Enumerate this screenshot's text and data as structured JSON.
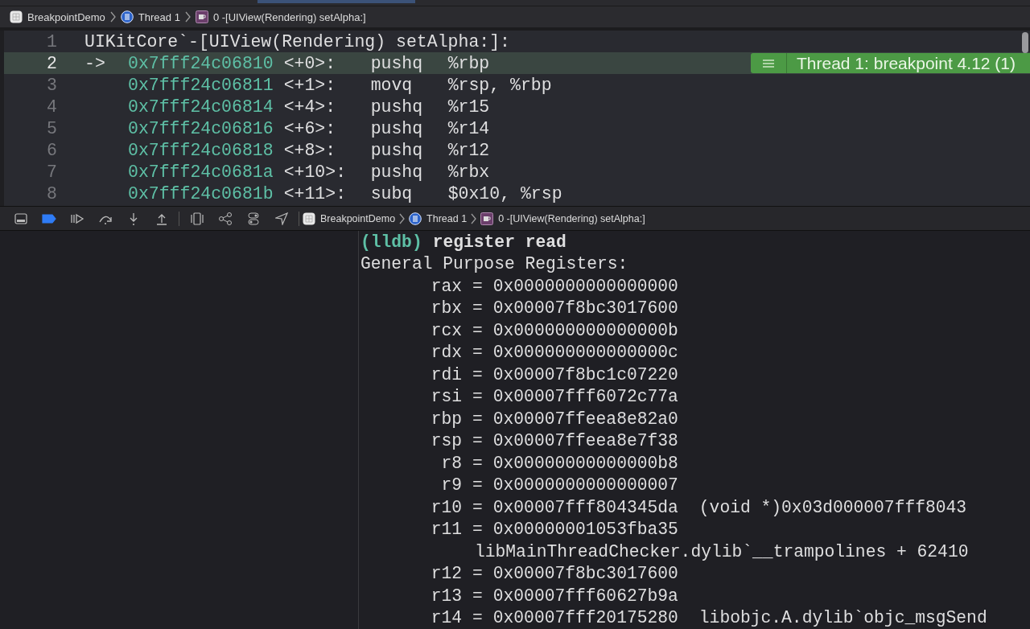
{
  "breadcrumb": [
    {
      "kind": "project",
      "label": "BreakpointDemo"
    },
    {
      "kind": "thread",
      "label": "Thread 1"
    },
    {
      "kind": "frame",
      "label": "0 -[UIView(Rendering) setAlpha:]"
    }
  ],
  "editor": {
    "lines": [
      {
        "number": "1",
        "kind": "header",
        "text": "UIKitCore`-[UIView(Rendering) setAlpha:]:",
        "current": false
      },
      {
        "number": "2",
        "kind": "instruction",
        "arrow": "->",
        "address": "0x7fff24c06810",
        "offset": "<+0>:",
        "mnemonic": "pushq",
        "operands": "%rbp",
        "current": true
      },
      {
        "number": "3",
        "kind": "instruction",
        "address": "0x7fff24c06811",
        "offset": "<+1>:",
        "mnemonic": "movq",
        "operands": "%rsp, %rbp",
        "current": false
      },
      {
        "number": "4",
        "kind": "instruction",
        "address": "0x7fff24c06814",
        "offset": "<+4>:",
        "mnemonic": "pushq",
        "operands": "%r15",
        "current": false
      },
      {
        "number": "5",
        "kind": "instruction",
        "address": "0x7fff24c06816",
        "offset": "<+6>:",
        "mnemonic": "pushq",
        "operands": "%r14",
        "current": false
      },
      {
        "number": "6",
        "kind": "instruction",
        "address": "0x7fff24c06818",
        "offset": "<+8>:",
        "mnemonic": "pushq",
        "operands": "%r12",
        "current": false
      },
      {
        "number": "7",
        "kind": "instruction",
        "address": "0x7fff24c0681a",
        "offset": "<+10>:",
        "mnemonic": "pushq",
        "operands": "%rbx",
        "current": false
      },
      {
        "number": "8",
        "kind": "instruction",
        "address": "0x7fff24c0681b",
        "offset": "<+11>:",
        "mnemonic": "subq",
        "operands": "$0x10, %rsp",
        "current": false
      }
    ],
    "breakpoint_badge": {
      "label": "Thread 1: breakpoint 4.12 (1)"
    }
  },
  "debug_bar": {
    "breakpoints_active": true,
    "breadcrumb": [
      {
        "kind": "project",
        "label": "BreakpointDemo"
      },
      {
        "kind": "thread",
        "label": "Thread 1"
      },
      {
        "kind": "frame",
        "label": "0 -[UIView(Rendering) setAlpha:]"
      }
    ]
  },
  "console": {
    "lines": [
      {
        "kind": "prompt",
        "prompt": "(lldb)",
        "command": "register read"
      },
      {
        "kind": "text",
        "text": "General Purpose Registers:"
      },
      {
        "kind": "register",
        "name": "rax",
        "equals": "=",
        "value": "0x0000000000000000"
      },
      {
        "kind": "register",
        "name": "rbx",
        "equals": "=",
        "value": "0x00007f8bc3017600"
      },
      {
        "kind": "register",
        "name": "rcx",
        "equals": "=",
        "value": "0x000000000000000b"
      },
      {
        "kind": "register",
        "name": "rdx",
        "equals": "=",
        "value": "0x000000000000000c"
      },
      {
        "kind": "register",
        "name": "rdi",
        "equals": "=",
        "value": "0x00007f8bc1c07220"
      },
      {
        "kind": "register",
        "name": "rsi",
        "equals": "=",
        "value": "0x00007fff6072c77a"
      },
      {
        "kind": "register",
        "name": "rbp",
        "equals": "=",
        "value": "0x00007ffeea8e82a0"
      },
      {
        "kind": "register",
        "name": "rsp",
        "equals": "=",
        "value": "0x00007ffeea8e7f38"
      },
      {
        "kind": "register",
        "name": "r8",
        "equals": "=",
        "value": "0x00000000000000b8"
      },
      {
        "kind": "register",
        "name": "r9",
        "equals": "=",
        "value": "0x0000000000000007"
      },
      {
        "kind": "register",
        "name": "r10",
        "equals": "=",
        "value": "0x00007fff804345da",
        "note": "(void *)0x03d000007fff8043"
      },
      {
        "kind": "register",
        "name": "r11",
        "equals": "=",
        "value": "0x00000001053fba35"
      },
      {
        "kind": "continuation",
        "text": "libMainThreadChecker.dylib`__trampolines + 62410"
      },
      {
        "kind": "register",
        "name": "r12",
        "equals": "=",
        "value": "0x00007f8bc3017600"
      },
      {
        "kind": "register",
        "name": "r13",
        "equals": "=",
        "value": "0x00007fff60627b9a"
      },
      {
        "kind": "register",
        "name": "r14",
        "equals": "=",
        "value": "0x00007fff20175280",
        "note": "libobjc.A.dylib`objc_msgSend"
      }
    ]
  }
}
